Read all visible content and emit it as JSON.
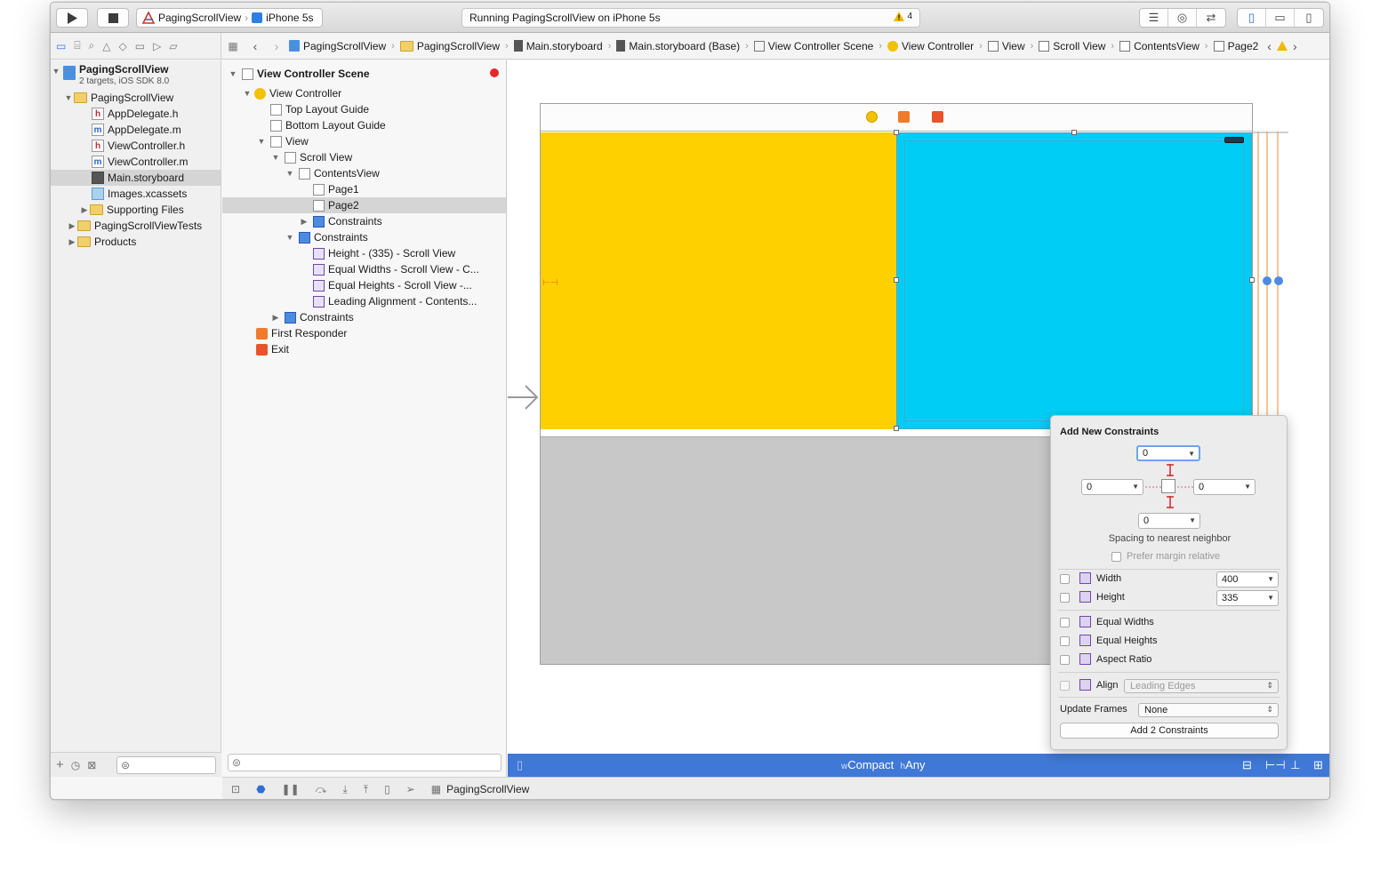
{
  "toolbar": {
    "scheme": "PagingScrollView",
    "device": "iPhone 5s",
    "status_text": "Running PagingScrollView on iPhone 5s",
    "warning_count": "4",
    "run_icon": "play-icon",
    "stop_icon": "stop-icon"
  },
  "jumpbar": {
    "crumbs": [
      "PagingScrollView",
      "PagingScrollView",
      "Main.storyboard",
      "Main.storyboard (Base)",
      "View Controller Scene",
      "View Controller",
      "View",
      "Scroll View",
      "ContentsView",
      "Page2"
    ]
  },
  "navigator": {
    "project_name": "PagingScrollView",
    "project_sub": "2 targets, iOS SDK 8.0",
    "group": "PagingScrollView",
    "files": [
      {
        "name": "AppDelegate.h",
        "badge": "h"
      },
      {
        "name": "AppDelegate.m",
        "badge": "m"
      },
      {
        "name": "ViewController.h",
        "badge": "h"
      },
      {
        "name": "ViewController.m",
        "badge": "m"
      },
      {
        "name": "Main.storyboard",
        "badge": ""
      },
      {
        "name": "Images.xcassets",
        "badge": ""
      }
    ],
    "supporting": "Supporting Files",
    "tests": "PagingScrollViewTests",
    "products": "Products"
  },
  "outline": {
    "scene": "View Controller Scene",
    "vc": "View Controller",
    "top_guide": "Top Layout Guide",
    "bottom_guide": "Bottom Layout Guide",
    "view": "View",
    "scroll": "Scroll View",
    "contents": "ContentsView",
    "page1": "Page1",
    "page2": "Page2",
    "constraints_inner": "Constraints",
    "constraints": "Constraints",
    "c1": "Height - (335) - Scroll View",
    "c2": "Equal Widths - Scroll View - C...",
    "c3": "Equal Heights - Scroll View -...",
    "c4": "Leading Alignment - Contents...",
    "constraints_outer": "Constraints",
    "first_responder": "First Responder",
    "exit": "Exit"
  },
  "sizeclass": {
    "w_prefix": "w",
    "w": "Compact",
    "h_prefix": "h",
    "h": "Any"
  },
  "debugbar": {
    "target": "PagingScrollView"
  },
  "popover": {
    "title": "Add New Constraints",
    "top": "0",
    "left": "0",
    "right": "0",
    "bottom": "0",
    "spacing_label": "Spacing to nearest neighbor",
    "margin_label": "Prefer margin relative",
    "width_label": "Width",
    "width_value": "400",
    "height_label": "Height",
    "height_value": "335",
    "equal_widths": "Equal Widths",
    "equal_heights": "Equal Heights",
    "aspect_ratio": "Aspect Ratio",
    "align_label": "Align",
    "align_value": "Leading Edges",
    "update_frames_label": "Update Frames",
    "update_frames_value": "None",
    "add_button": "Add 2 Constraints"
  },
  "colors": {
    "page1": "#ffd000",
    "page2": "#00cdf5",
    "accent": "#3f78d6"
  }
}
